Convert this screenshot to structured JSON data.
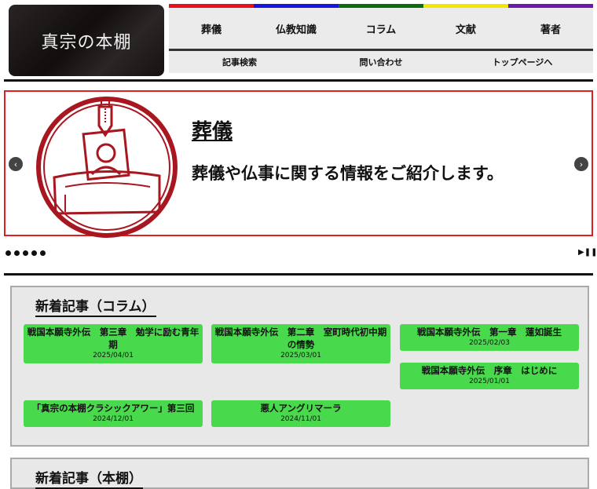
{
  "site": {
    "logo_text": "真宗の本棚"
  },
  "nav": {
    "colors": [
      "#e8101a",
      "#1515e0",
      "#0d6a0d",
      "#f0e800",
      "#6a1ab0"
    ],
    "main": [
      "葬儀",
      "仏教知識",
      "コラム",
      "文献",
      "著者"
    ],
    "sub": [
      "記事検索",
      "問い合わせ",
      "トップページへ"
    ]
  },
  "slider": {
    "title": "葬儀",
    "text": "葬儀や仏事に関する情報をご紹介します。",
    "prev_icon": "‹",
    "next_icon": "›",
    "play_pause": "▶❚❚",
    "slide_count": 5,
    "accent_color": "#e02020",
    "icon": "funeral-icon"
  },
  "new_column": {
    "title": "新着記事（コラム）",
    "articles": [
      {
        "title": "戦国本願寺外伝　第三章　勉学に励む青年期",
        "date": "2025/04/01"
      },
      {
        "title": "戦国本願寺外伝　第二章　室町時代初中期の情勢",
        "date": "2025/03/01"
      },
      {
        "title": "戦国本願寺外伝　第一章　蓮如誕生",
        "date": "2025/02/03"
      },
      {
        "title": "戦国本願寺外伝　序章　はじめに",
        "date": "2025/01/01"
      },
      {
        "title": "「真宗の本棚クラシックアワー」第三回",
        "date": "2024/12/01"
      },
      {
        "title": "悪人アングリマーラ",
        "date": "2024/11/01"
      }
    ]
  },
  "next_panel": {
    "title": "新着記事（本棚）"
  }
}
